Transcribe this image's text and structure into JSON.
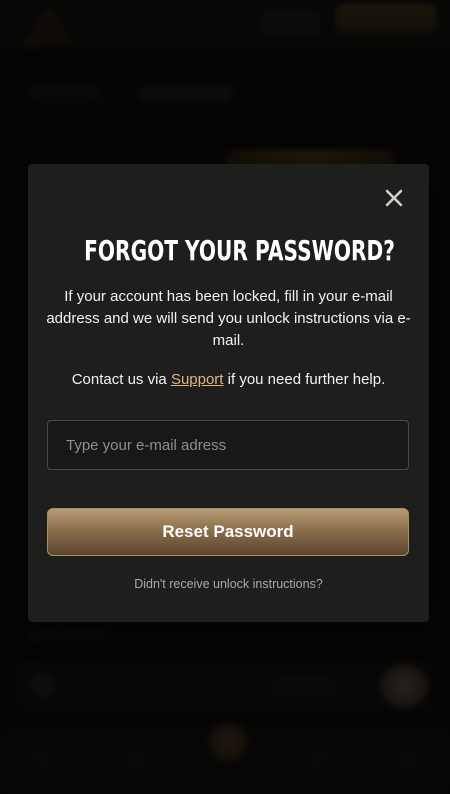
{
  "modal": {
    "title": "FORGOT YOUR PASSWORD?",
    "description": "If your account has been locked, fill in your e-mail address and we will send you unlock instructions via e-mail.",
    "contact_prefix": "Contact us via ",
    "contact_link": "Support",
    "contact_suffix": " if you need further help.",
    "email_placeholder": "Type your e-mail adress",
    "email_value": "",
    "reset_button": "Reset Password",
    "resend_link": "Didn't receive unlock instructions?",
    "close_icon": "close-icon"
  },
  "colors": {
    "accent": "#d8b884",
    "button_top": "#b89c74",
    "button_bottom": "#5b4630",
    "modal_bg": "#1e1e1d",
    "text": "#ffffff",
    "muted": "#a9a9a6"
  }
}
